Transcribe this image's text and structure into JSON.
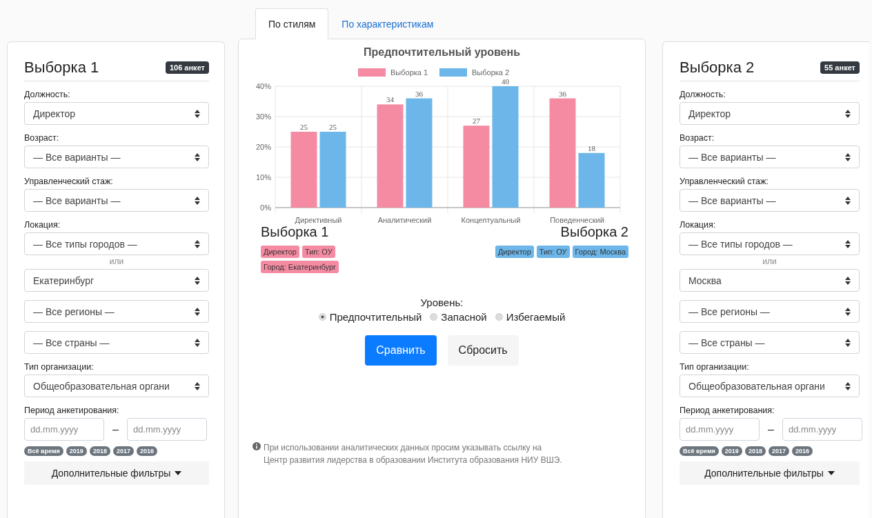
{
  "tabs": [
    {
      "label": "По стилям",
      "selected": true
    },
    {
      "label": "По характеристикам",
      "selected": false
    }
  ],
  "filters": [
    {
      "title": "Выборка 1",
      "count": "106 анкет",
      "items": [
        {
          "kind": "label",
          "text": "Должность:"
        },
        {
          "kind": "select",
          "value": "Директор"
        },
        {
          "kind": "label",
          "text": "Возраст:"
        },
        {
          "kind": "select",
          "value": "— Все варианты —"
        },
        {
          "kind": "label",
          "text": "Управленческий стаж:"
        },
        {
          "kind": "select",
          "value": "— Все варианты —"
        },
        {
          "kind": "label",
          "text": "Локация:"
        },
        {
          "kind": "select",
          "value": "— Все типы городов —"
        },
        {
          "kind": "separator",
          "text": "или"
        },
        {
          "kind": "select",
          "value": "Екатеринбург"
        },
        {
          "kind": "select",
          "value": "— Все регионы —"
        },
        {
          "kind": "select",
          "value": "— Все страны —"
        },
        {
          "kind": "label",
          "text": "Тип организации:"
        },
        {
          "kind": "select",
          "value": "Общеобразовательная органи"
        },
        {
          "kind": "label",
          "text": "Период анкетирования:"
        },
        {
          "kind": "dates",
          "fields": [
            {
              "placeholder": "dd.mm.yyyy"
            },
            {
              "placeholder": "dd.mm.yyyy"
            }
          ],
          "dash": "–"
        },
        {
          "kind": "chips",
          "chips": [
            "Всё время",
            "2019",
            "2018",
            "2017",
            "2016"
          ]
        },
        {
          "kind": "more",
          "text": "Дополнительные фильтры"
        }
      ]
    },
    {
      "title": "Выборка 2",
      "count": "55 анкет",
      "items": [
        {
          "kind": "label",
          "text": "Должность:"
        },
        {
          "kind": "select",
          "value": "Директор"
        },
        {
          "kind": "label",
          "text": "Возраст:"
        },
        {
          "kind": "select",
          "value": "— Все варианты —"
        },
        {
          "kind": "label",
          "text": "Управленческий стаж:"
        },
        {
          "kind": "select",
          "value": "— Все варианты —"
        },
        {
          "kind": "label",
          "text": "Локация:"
        },
        {
          "kind": "select",
          "value": "— Все типы городов —"
        },
        {
          "kind": "separator",
          "text": "или"
        },
        {
          "kind": "select",
          "value": "Москва"
        },
        {
          "kind": "select",
          "value": "— Все регионы —"
        },
        {
          "kind": "select",
          "value": "— Все страны —"
        },
        {
          "kind": "label",
          "text": "Тип организации:"
        },
        {
          "kind": "select",
          "value": "Общеобразовательная органи"
        },
        {
          "kind": "label",
          "text": "Период анкетирования:"
        },
        {
          "kind": "dates",
          "fields": [
            {
              "placeholder": "dd.mm.yyyy"
            },
            {
              "placeholder": "dd.mm.yyyy"
            }
          ],
          "dash": "–"
        },
        {
          "kind": "chips",
          "chips": [
            "Всё время",
            "2019",
            "2018",
            "2017",
            "2016"
          ]
        },
        {
          "kind": "more",
          "text": "Дополнительные фильтры"
        }
      ]
    }
  ],
  "chart_data": {
    "type": "bar",
    "title": "Предпочтительный уровень",
    "categories": [
      "Директивный",
      "Аналитический",
      "Концептуальный",
      "Поведенческий"
    ],
    "series": [
      {
        "name": "Выборка 1",
        "color": "#f58ba3",
        "values": [
          25,
          34,
          27,
          36
        ]
      },
      {
        "name": "Выборка 2",
        "color": "#6cb6ea",
        "values": [
          25,
          36,
          40,
          18
        ]
      }
    ],
    "grid": true,
    "legend": true,
    "ylim": [
      0,
      40
    ],
    "yticks": [
      {
        "value": 0,
        "label": "0%"
      },
      {
        "value": 10,
        "label": "10%"
      },
      {
        "value": 20,
        "label": "20%"
      },
      {
        "value": 30,
        "label": "30%"
      },
      {
        "value": 40,
        "label": "40%"
      }
    ],
    "data_labels": true
  },
  "samples": [
    {
      "title": "Выборка 1",
      "color": "#f58ba3",
      "tags": [
        "Директор",
        "Тип: ОУ",
        "Город: Екатеринбург"
      ]
    },
    {
      "title": "Выборка 2",
      "color": "#6cb6ea",
      "tags": [
        "Директор",
        "Тип: ОУ",
        "Город: Москва"
      ]
    }
  ],
  "level": {
    "label": "Уровень:",
    "options": [
      {
        "label": "Предпочтительный",
        "selected": true
      },
      {
        "label": "Запасной",
        "selected": false
      },
      {
        "label": "Избегаемый",
        "selected": false
      }
    ]
  },
  "buttons": [
    {
      "label": "Сравнить",
      "kind": "primary"
    },
    {
      "label": "Сбросить",
      "kind": "secondary"
    }
  ],
  "note_lines": [
    "При использовании аналитических данных просим указывать ссылку на",
    "Центр развития лидерства в образовании Института образования НИУ ВШЭ."
  ]
}
